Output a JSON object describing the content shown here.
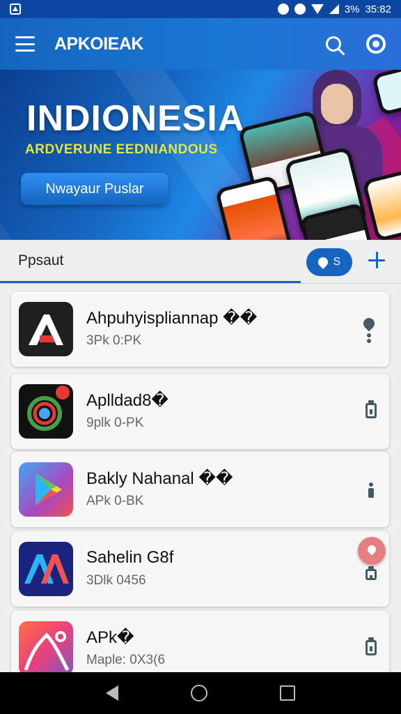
{
  "status_bar": {
    "battery": "3%",
    "time": "35:82"
  },
  "app_bar": {
    "title": "APKOIEAK"
  },
  "banner": {
    "title": "INDIONESIA",
    "subtitle": "ARDVERUNE EEDNIANDOUS",
    "button_label": "Nwayaur Puslar"
  },
  "tabs": {
    "active_label": "Ppsaut",
    "chip_label": "S"
  },
  "apps": [
    {
      "name": "Ahpuhyispliannap ��",
      "meta": "3Pk 0:PK",
      "icon": "red-a-logo-icon",
      "action": "location-info-icon"
    },
    {
      "name": "Aplldad8�",
      "meta": "9plk 0-PK",
      "icon": "color-wheel-icon",
      "action": "download-icon"
    },
    {
      "name": "Bakly Nahanal ��",
      "meta": "APk 0-BK",
      "icon": "play-store-icon",
      "action": "info-icon"
    },
    {
      "name": "Sahelin G8f",
      "meta": "3Dlk 0456",
      "icon": "aa-logo-icon",
      "action": "download-icon"
    },
    {
      "name": "APk�",
      "meta": "Maple: 0X3(6",
      "icon": "gallery-art-icon",
      "action": "download-icon"
    }
  ],
  "colors": {
    "primary": "#1565c0",
    "accent": "#e57373"
  }
}
